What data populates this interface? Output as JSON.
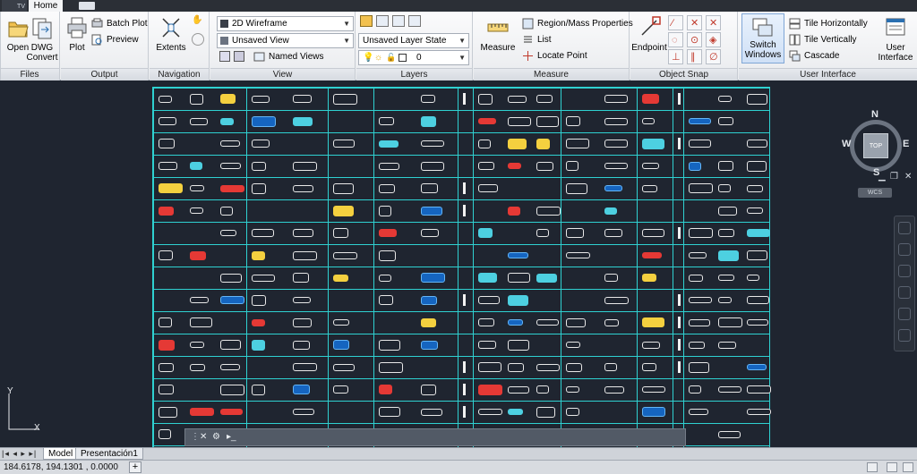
{
  "app_badge": "TV",
  "tabs": {
    "home": "Home"
  },
  "panels": {
    "files": {
      "title": "Files",
      "open": "Open",
      "dwg_convert_1": "DWG",
      "dwg_convert_2": "Convert"
    },
    "output": {
      "title": "Output",
      "plot": "Plot",
      "batch_plot": "Batch Plot",
      "preview": "Preview"
    },
    "navigation": {
      "title": "Navigation",
      "extents": "Extents"
    },
    "view": {
      "title": "View",
      "visual_style": "2D Wireframe",
      "saved_view": "Unsaved View",
      "named_views": "Named Views"
    },
    "layers": {
      "title": "Layers",
      "layer_state": "Unsaved Layer State",
      "current_layer": "0"
    },
    "measure": {
      "title": "Measure",
      "measure": "Measure",
      "region_mass": "Region/Mass Properties",
      "list": "List",
      "locate_point": "Locate Point"
    },
    "object_snap": {
      "title": "Object Snap",
      "endpoint": "Endpoint"
    },
    "user_interface": {
      "title": "User Interface",
      "switch_1": "Switch",
      "switch_2": "Windows",
      "tile_h": "Tile Horizontally",
      "tile_v": "Tile Vertically",
      "cascade": "Cascade",
      "user_1": "User",
      "user_2": "Interface"
    }
  },
  "viewcube": {
    "n": "N",
    "s": "S",
    "e": "E",
    "w": "W",
    "face": "TOP",
    "wcs": "WCS"
  },
  "ucs": {
    "y": "Y",
    "x": "X"
  },
  "layout_tabs": {
    "model": "Model",
    "layout1": "Presentación1"
  },
  "status": {
    "coordinates": "184.6178, 194.1301 , 0.0000"
  },
  "colors": {
    "grid": "#2fd1d1",
    "background": "#1f2530",
    "highlight_yellow": "#f4d03f",
    "highlight_red": "#e53935"
  }
}
